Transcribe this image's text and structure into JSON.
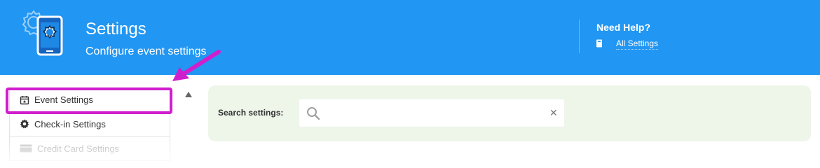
{
  "header": {
    "title": "Settings",
    "subtitle": "Configure event settings",
    "icon": "phone-settings-icon",
    "background": "#2196f3"
  },
  "help": {
    "title": "Need Help?",
    "link_label": "All Settings",
    "link_icon": "book-icon"
  },
  "sidebar": {
    "items": [
      {
        "label": "Event Settings",
        "icon": "calendar-icon",
        "highlighted": true
      },
      {
        "label": "Check-in Settings",
        "icon": "gear-icon"
      },
      {
        "label": "Credit Card Settings",
        "icon": "credit-card-icon"
      }
    ]
  },
  "search": {
    "label": "Search settings:",
    "value": "",
    "placeholder": "",
    "panel_color": "#eef5e9"
  },
  "annotation": {
    "color": "#d11ecd",
    "type": "arrow-and-box"
  }
}
